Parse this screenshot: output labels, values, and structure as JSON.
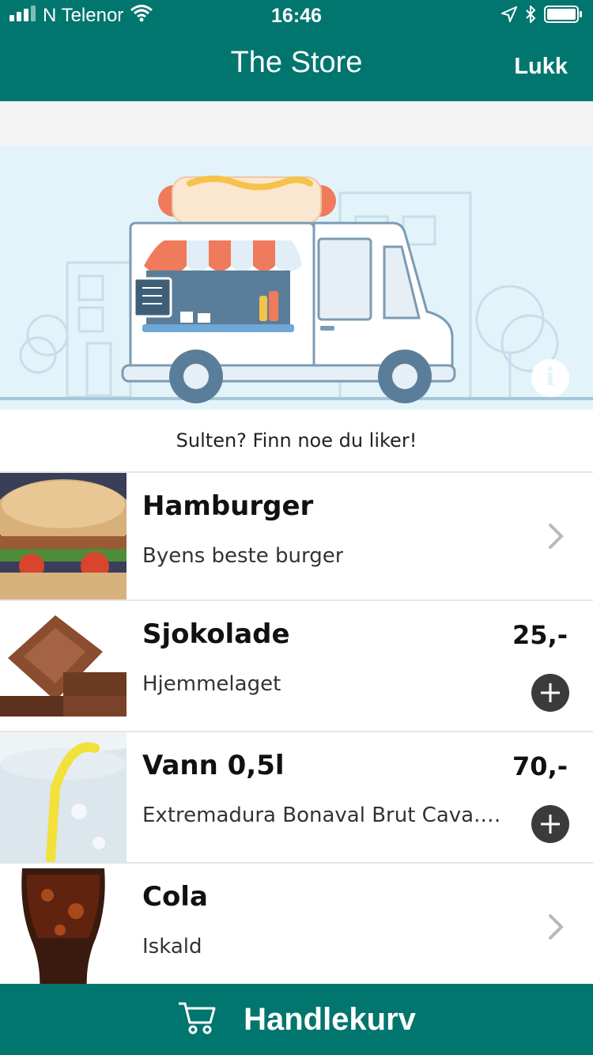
{
  "status_bar": {
    "carrier": "N Telenor",
    "time": "16:46"
  },
  "nav": {
    "title": "The Store",
    "close_label": "Lukk"
  },
  "hero": {
    "tagline": "Sulten? Finn noe du liker!",
    "info_icon": "info-icon",
    "colors": {
      "background": "#E2F3FA"
    }
  },
  "items": [
    {
      "title": "Hamburger",
      "subtitle": "Byens beste burger",
      "price": "",
      "action": "chevron-right-icon"
    },
    {
      "title": "Sjokolade",
      "subtitle": "Hjemmelaget",
      "price": "25,-",
      "action": "plus-icon"
    },
    {
      "title": "Vann 0,5l",
      "subtitle": "Extremadura Bonaval Brut Cava. ...",
      "price": "70,-",
      "action": "plus-icon"
    },
    {
      "title": "Cola",
      "subtitle": "Iskald",
      "price": "",
      "action": "chevron-right-icon"
    }
  ],
  "cart": {
    "label": "Handlekurv",
    "icon": "cart-icon"
  },
  "colors": {
    "brand": "#00766E",
    "text": "#111111",
    "muted": "#333333"
  }
}
